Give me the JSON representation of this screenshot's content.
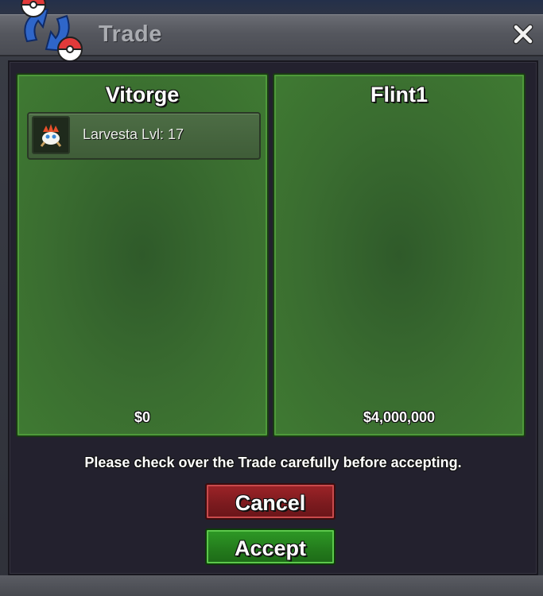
{
  "window": {
    "title": "Trade",
    "accent_title_color": "#a9abb0"
  },
  "icons": {
    "logo": "trade-swap-icon",
    "close": "close-icon",
    "item": "larvesta-sprite-icon"
  },
  "trade": {
    "left": {
      "player": "Vitorge",
      "items": [
        {
          "label": "Larvesta  Lvl: 17"
        }
      ],
      "money": "$0"
    },
    "right": {
      "player": "Flint1",
      "items": [],
      "money": "$4,000,000"
    }
  },
  "notice": "Please check over the Trade carefully before accepting.",
  "buttons": {
    "cancel": "Cancel",
    "accept": "Accept"
  },
  "colors": {
    "panel_green": "#3f7a32",
    "cancel_red": "#9e2428",
    "accept_green": "#2e9a26"
  }
}
